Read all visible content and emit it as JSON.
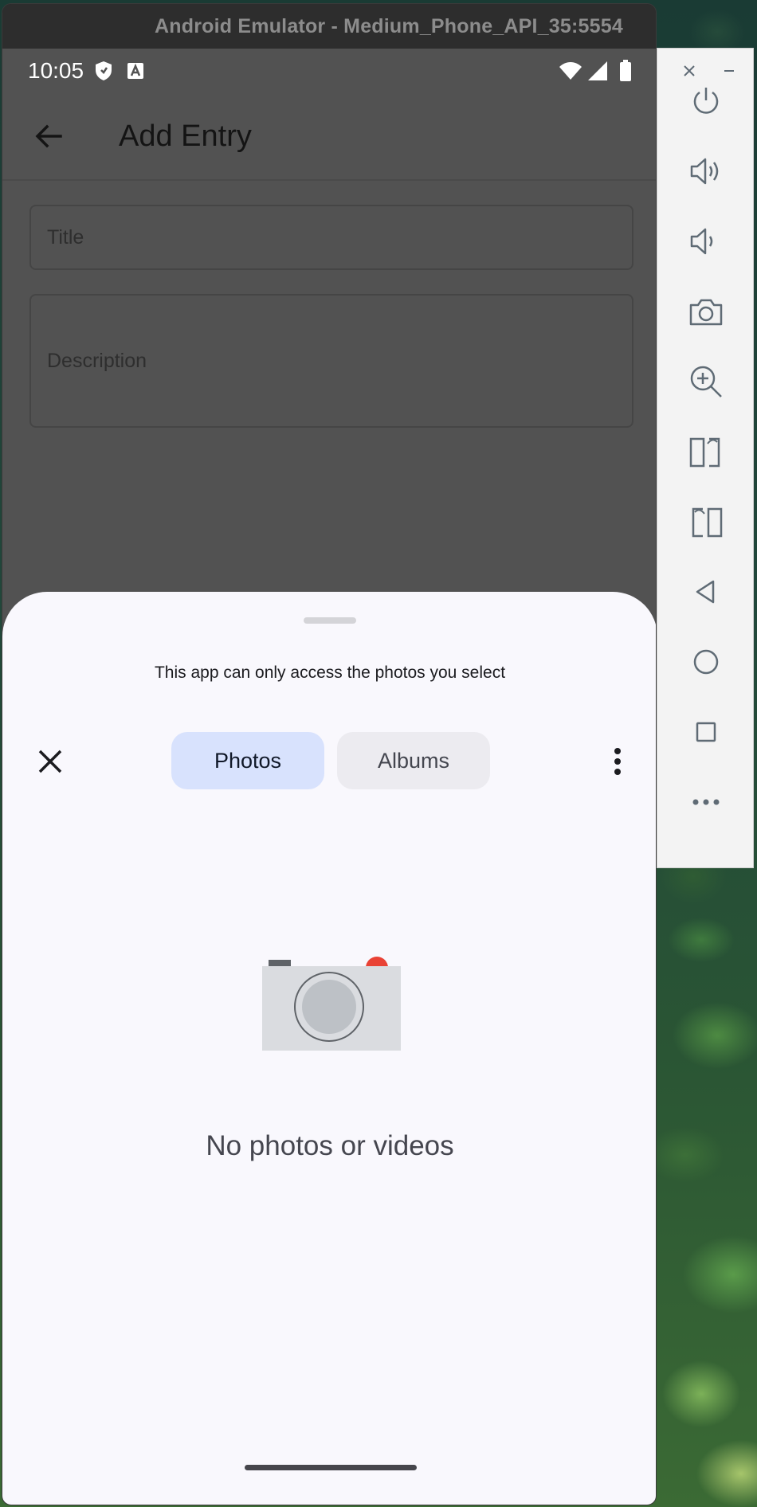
{
  "window": {
    "title": "Android Emulator - Medium_Phone_API_35:5554"
  },
  "statusbar": {
    "time": "10:05",
    "icons": [
      "shield-icon",
      "a-notification-icon",
      "wifi-icon",
      "signal-icon",
      "battery-icon"
    ]
  },
  "appbar": {
    "title": "Add Entry",
    "back_icon": "arrow-left-icon"
  },
  "form": {
    "title_placeholder": "Title",
    "description_placeholder": "Description"
  },
  "picker_sheet": {
    "notice": "This app can only access the photos you select",
    "tabs": [
      {
        "label": "Photos",
        "selected": true
      },
      {
        "label": "Albums",
        "selected": false
      }
    ],
    "empty_message": "No photos or videos",
    "empty_icon": "camera-illustration-icon"
  },
  "emulator_toolbar": {
    "buttons": [
      "power-icon",
      "volume-up-icon",
      "volume-down-icon",
      "camera-icon",
      "zoom-in-icon",
      "rotate-left-icon",
      "rotate-right-icon",
      "back-triangle-icon",
      "home-circle-icon",
      "overview-square-icon",
      "more-horizontal-icon"
    ]
  },
  "colors": {
    "scrim": "#525252",
    "sheet_bg": "#f9f8fd",
    "tab_selected_bg": "#d8e2fd",
    "tab_unselected_bg": "#ecebf0",
    "camera_red": "#e94235"
  }
}
